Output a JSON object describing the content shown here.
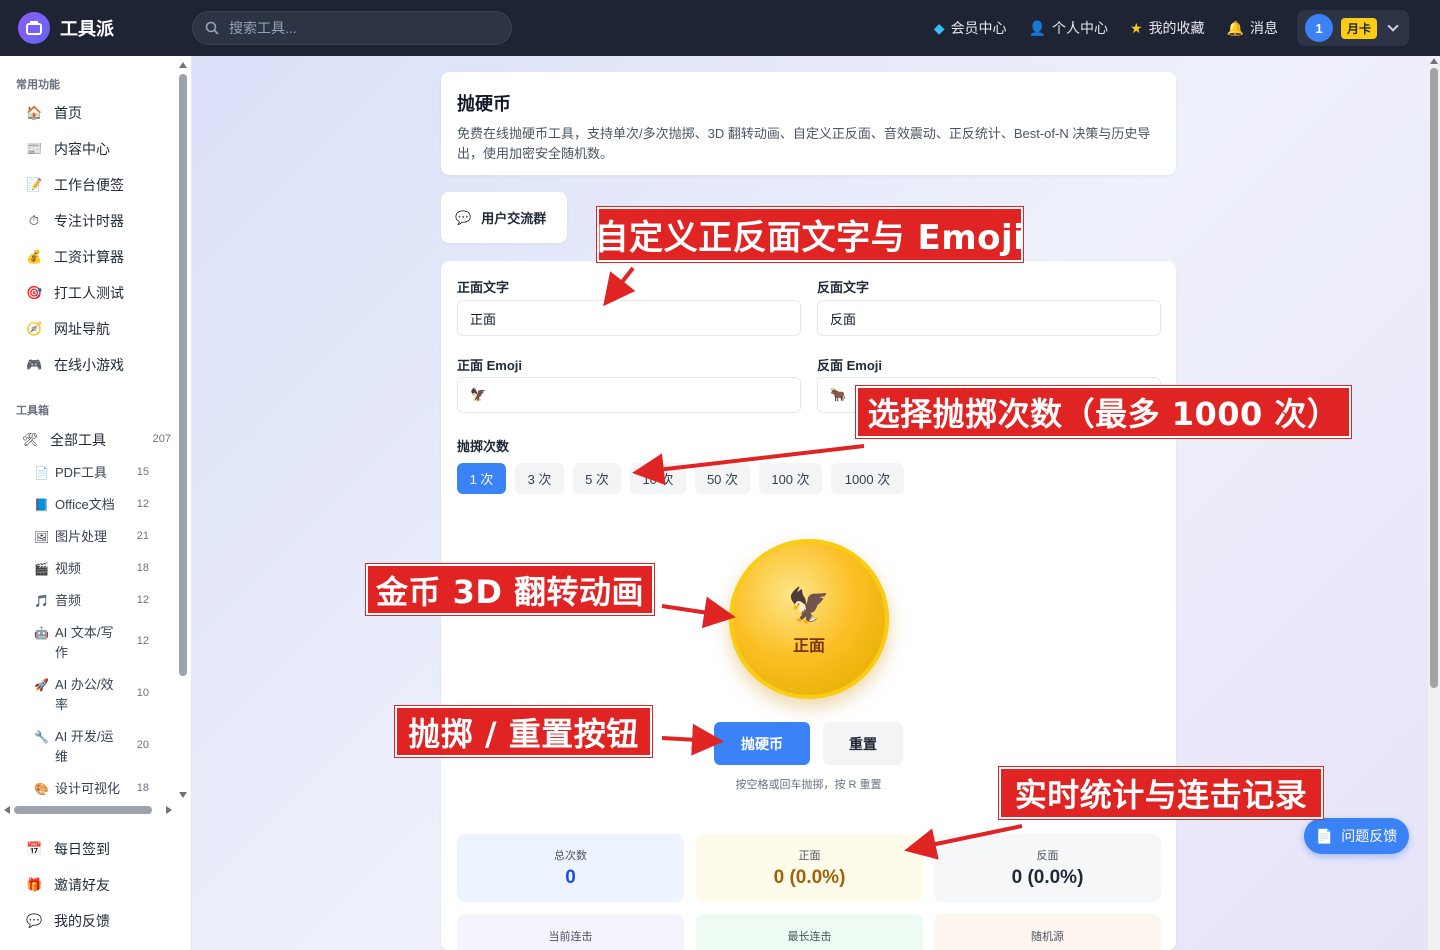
{
  "header": {
    "logo_text": "工具派",
    "search_placeholder": "搜索工具...",
    "nav": [
      {
        "icon": "gem-icon",
        "label": "会员中心"
      },
      {
        "icon": "person-icon",
        "label": "个人中心"
      },
      {
        "icon": "star-icon",
        "label": "我的收藏"
      },
      {
        "icon": "bell-icon",
        "label": "消息"
      }
    ],
    "user_avatar": "1",
    "vip_badge": "月卡"
  },
  "sidebar": {
    "section_common": "常用功能",
    "common": [
      {
        "icon": "home-icon",
        "glyph": "🏠",
        "label": "首页"
      },
      {
        "icon": "news-icon",
        "glyph": "📰",
        "label": "内容中心"
      },
      {
        "icon": "memo-icon",
        "glyph": "📝",
        "label": "工作台便签"
      },
      {
        "icon": "timer-icon",
        "glyph": "⏱",
        "label": "专注计时器"
      },
      {
        "icon": "money-bag-icon",
        "glyph": "💰",
        "label": "工资计算器"
      },
      {
        "icon": "target-icon",
        "glyph": "🎯",
        "label": "打工人测试"
      },
      {
        "icon": "compass-icon",
        "glyph": "🧭",
        "label": "网址导航"
      },
      {
        "icon": "gamepad-icon",
        "glyph": "🎮",
        "label": "在线小游戏"
      }
    ],
    "section_tools": "工具箱",
    "all_tools": {
      "glyph": "🛠",
      "label": "全部工具",
      "count": "207"
    },
    "tools": [
      {
        "icon": "pdf-icon",
        "glyph": "📄",
        "label": "PDF工具",
        "count": "15"
      },
      {
        "icon": "office-icon",
        "glyph": "📘",
        "label": "Office文档",
        "count": "12"
      },
      {
        "icon": "image-icon",
        "glyph": "🖼",
        "label": "图片处理",
        "count": "21"
      },
      {
        "icon": "video-icon",
        "glyph": "🎬",
        "label": "视频",
        "count": "18"
      },
      {
        "icon": "music-icon",
        "glyph": "🎵",
        "label": "音频",
        "count": "12"
      },
      {
        "icon": "robot-icon",
        "glyph": "🤖",
        "label": "AI 文本/写作",
        "count": "12"
      },
      {
        "icon": "rocket-icon",
        "glyph": "🚀",
        "label": "AI 办公/效率",
        "count": "10"
      },
      {
        "icon": "wrench-icon",
        "glyph": "🔧",
        "label": "AI 开发/运维",
        "count": "20"
      },
      {
        "icon": "palette-icon",
        "glyph": "🎨",
        "label": "设计可视化",
        "count": "18"
      }
    ],
    "bottom": [
      {
        "icon": "calendar-icon",
        "glyph": "📅",
        "label": "每日签到"
      },
      {
        "icon": "gift-icon",
        "glyph": "🎁",
        "label": "邀请好友"
      },
      {
        "icon": "chat-icon",
        "glyph": "💬",
        "label": "我的反馈"
      }
    ]
  },
  "page": {
    "title": "抛硬币",
    "description": "免费在线抛硬币工具，支持单次/多次抛掷、3D 翻转动画、自定义正反面、音效震动、正反统计、Best-of-N 决策与历史导出，使用加密安全随机数。",
    "group_label": "用户交流群"
  },
  "form": {
    "front_text_label": "正面文字",
    "front_text_value": "正面",
    "back_text_label": "反面文字",
    "back_text_value": "反面",
    "front_emoji_label": "正面 Emoji",
    "front_emoji_value": "🦅",
    "back_emoji_label": "反面 Emoji",
    "back_emoji_value": "🐂",
    "count_label": "抛掷次数",
    "counts": [
      "1 次",
      "3 次",
      "5 次",
      "10 次",
      "50 次",
      "100 次",
      "1000 次"
    ],
    "selected_count": "1 次"
  },
  "coin": {
    "emoji": "🦅",
    "face": "正面"
  },
  "actions": {
    "toss_label": "抛硬币",
    "reset_label": "重置",
    "hint": "按空格或回车抛掷，按 R 重置"
  },
  "stats": [
    {
      "label": "总次数",
      "value": "0",
      "color": "#1d4ed8",
      "bg": "#eef4ff"
    },
    {
      "label": "正面",
      "value": "0 (0.0%)",
      "color": "#a16207",
      "bg": "#fefbea"
    },
    {
      "label": "反面",
      "value": "0 (0.0%)",
      "color": "#1f2937",
      "bg": "#f6f7f9"
    }
  ],
  "stats2": [
    {
      "label": "当前连击",
      "bg": "#f6f2fe"
    },
    {
      "label": "最长连击",
      "bg": "#eefbf3"
    },
    {
      "label": "随机源",
      "bg": "#fdf5ee"
    }
  ],
  "annotations": {
    "custom": "自定义正反面文字与 Emoji",
    "count": "选择抛掷次数（最多 1000 次）",
    "coin": "金币 3D 翻转动画",
    "buttons": "抛掷 / 重置按钮",
    "stats": "实时统计与连击记录"
  },
  "feedback_label": "问题反馈",
  "accent_color": "#3b82f6",
  "annotation_color": "#e02424"
}
